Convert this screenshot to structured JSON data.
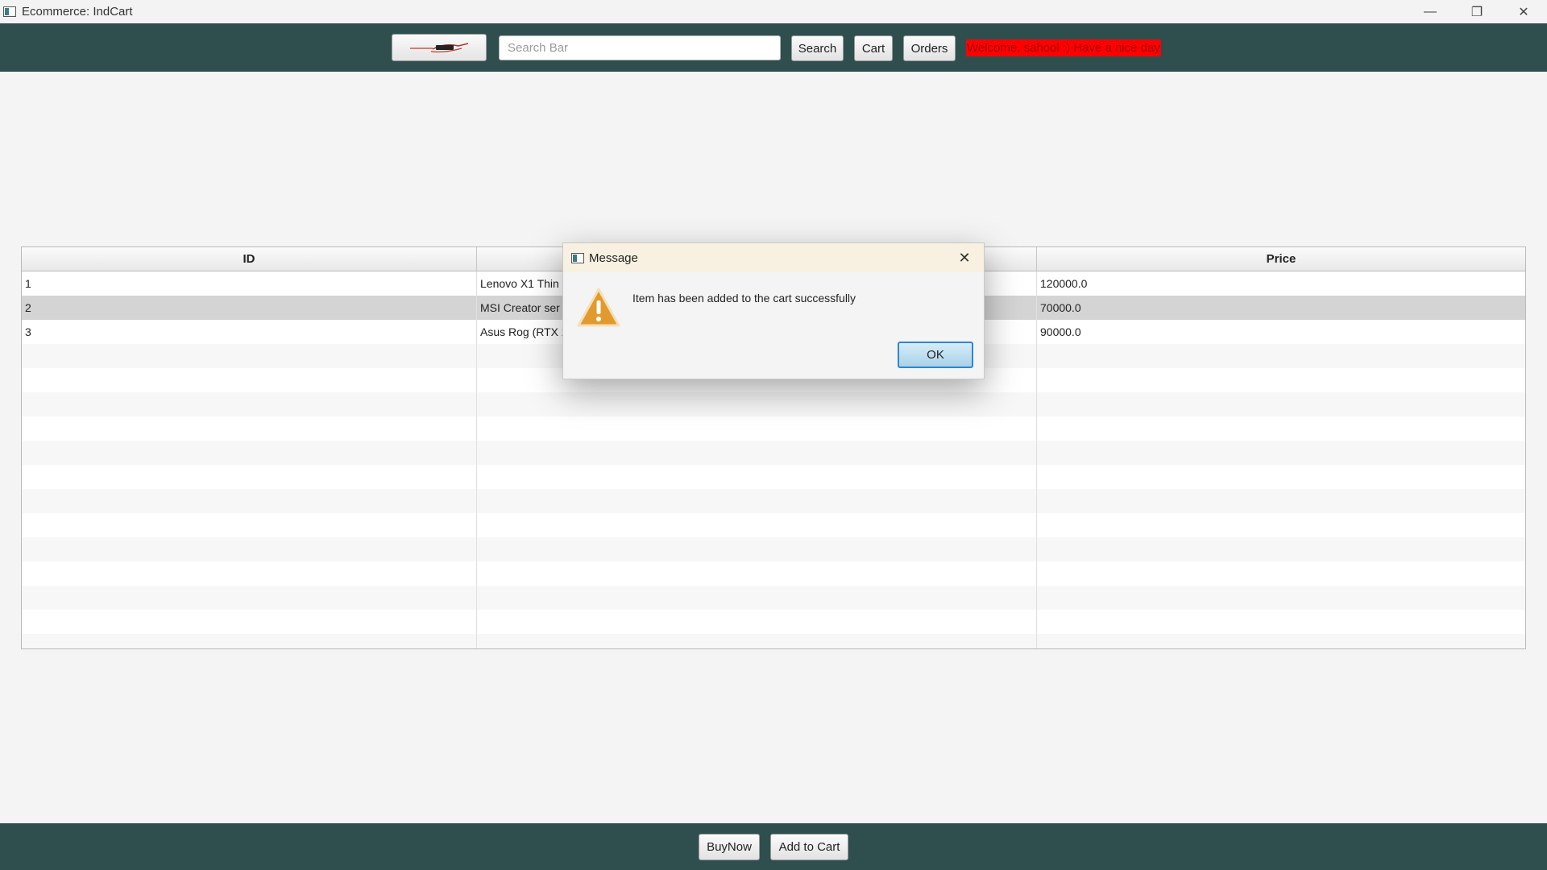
{
  "window": {
    "title": "Ecommerce: IndCart",
    "controls": {
      "minimize": "—",
      "restore": "❐",
      "close": "✕"
    }
  },
  "toolbar": {
    "logo_icon": "indcart-logo-icon",
    "search": {
      "placeholder": "Search Bar",
      "value": ""
    },
    "search_label": "Search",
    "cart_label": "Cart",
    "orders_label": "Orders",
    "welcome_text": "Welcome, sahool :) Have a nice day",
    "welcome_bg": "#ff0000"
  },
  "table": {
    "columns": [
      "ID",
      "",
      "Price"
    ],
    "rows": [
      {
        "id": "1",
        "name": "Lenovo X1 Thin",
        "price": "120000.0"
      },
      {
        "id": "2",
        "name": "MSI Creator ser",
        "price": "70000.0",
        "selected": true
      },
      {
        "id": "3",
        "name": "Asus Rog (RTX 2",
        "price": "90000.0"
      }
    ]
  },
  "dialog": {
    "title": "Message",
    "icon": "warning-icon",
    "message": "Item has been added to the cart successfully",
    "ok_label": "OK"
  },
  "bottombar": {
    "buynow_label": "BuyNow",
    "add_to_cart_label": "Add to Cart"
  },
  "colors": {
    "bar_bg": "#2f4f4f",
    "welcome_bg": "#ff0000",
    "ok_border": "#2f86c8"
  }
}
